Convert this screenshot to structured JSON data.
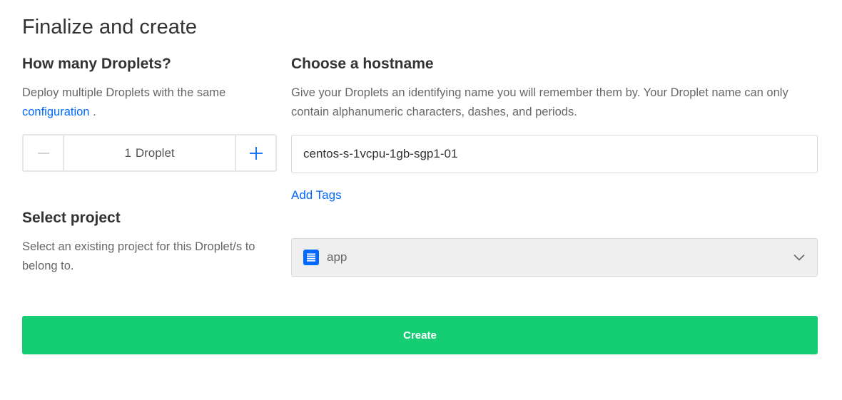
{
  "page": {
    "title": "Finalize and create"
  },
  "droplets": {
    "title": "How many Droplets?",
    "description": "Deploy multiple Droplets with the same",
    "link_text": "configuration",
    "after_link": " .",
    "count": "1",
    "unit": "Droplet",
    "minus_icon": "minus-icon",
    "plus_icon": "plus-icon"
  },
  "hostname": {
    "title": "Choose a hostname",
    "description": "Give your Droplets an identifying name you will remember them by. Your Droplet name can only contain alphanumeric characters, dashes, and periods.",
    "value": "centos-s-1vcpu-1gb-sgp1-01",
    "add_tags_label": "Add Tags"
  },
  "project": {
    "title": "Select project",
    "description": "Select an existing project for this Droplet/s to belong to.",
    "selected": "app",
    "icon": "project-icon",
    "dropdown_icon": "chevron-down-icon"
  },
  "actions": {
    "create_label": "Create"
  },
  "colors": {
    "accent": "#0069ff",
    "create_button": "#15cd72"
  }
}
